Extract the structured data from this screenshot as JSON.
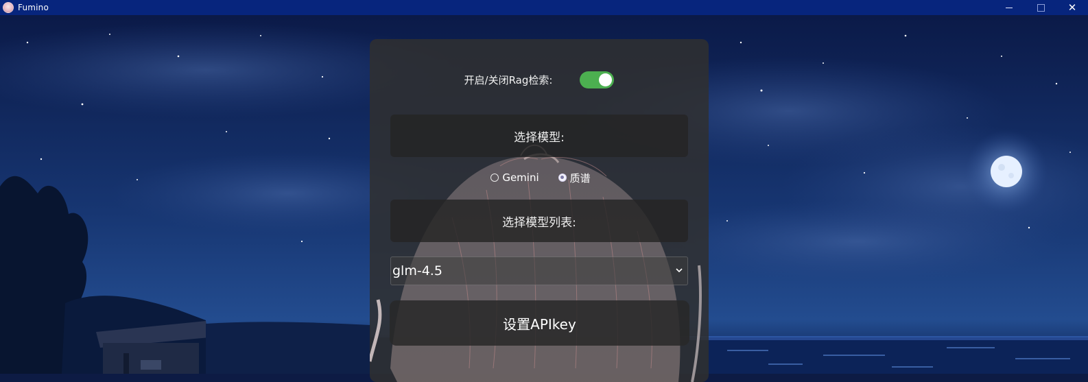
{
  "window": {
    "title": "Fumino",
    "icons": {
      "app": "app-avatar-icon",
      "minimize": "minimize-icon",
      "maximize": "maximize-icon",
      "close": "close-icon"
    },
    "close_glyph": "✕"
  },
  "panel": {
    "rag_toggle": {
      "label": "开启/关闭Rag检索:",
      "on": true,
      "color": "#4caf50"
    },
    "model_header": "选择模型:",
    "providers": [
      {
        "label": "Gemini",
        "checked": false
      },
      {
        "label": "质谱",
        "checked": true
      }
    ],
    "model_list_header": "选择模型列表:",
    "model_select": {
      "value": "glm-4.5",
      "icon": "chevron-down-icon"
    },
    "apikey_button": "设置APIkey"
  },
  "colors": {
    "titlebar": "#07257d",
    "sky_top": "#0f2257",
    "sky_bottom": "#1b3c78",
    "panel_bg": "#303030"
  }
}
